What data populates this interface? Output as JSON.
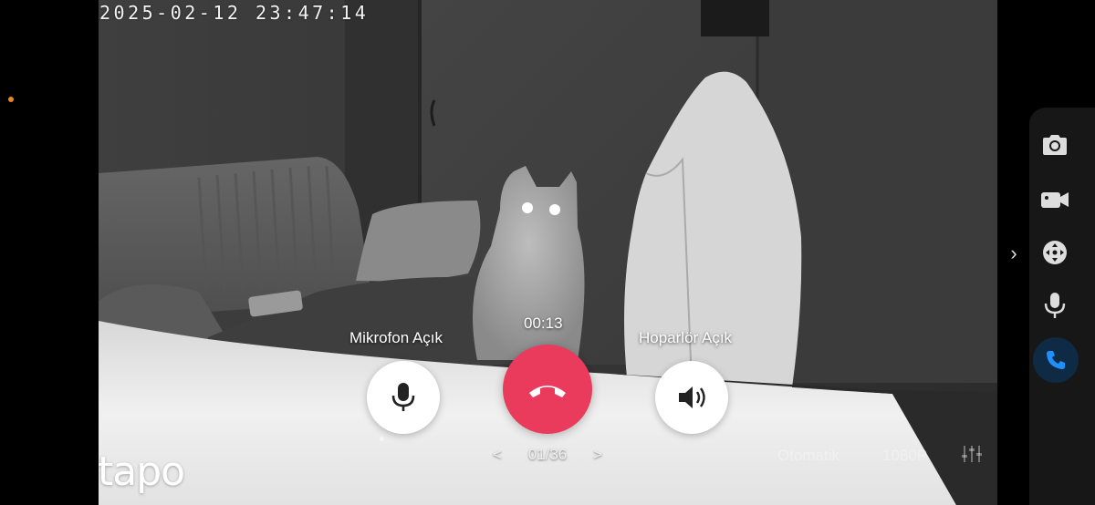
{
  "overlay": {
    "timestamp": "2025-02-12 23:47:14",
    "brand": "tapo"
  },
  "call": {
    "mic_label": "Mikrofon Açık",
    "speaker_label": "Hoparlör Açık",
    "duration": "00:13"
  },
  "pager": {
    "prev": "<",
    "page": "01/36",
    "next": ">"
  },
  "bottom_bar": {
    "quality_mode": "Otomatik",
    "resolution": "1080P"
  },
  "right_rail": {
    "expand": "›",
    "actions": [
      {
        "name": "snapshot",
        "icon": "camera-icon"
      },
      {
        "name": "record",
        "icon": "video-camera-icon"
      },
      {
        "name": "pan-tilt",
        "icon": "direction-pad-icon"
      },
      {
        "name": "talk",
        "icon": "microphone-icon"
      },
      {
        "name": "call",
        "icon": "phone-icon",
        "active": true
      }
    ]
  },
  "colors": {
    "hangup": "#ea3b5c",
    "active_call": "#1f8fff",
    "status_dot": "#e58a1f"
  }
}
